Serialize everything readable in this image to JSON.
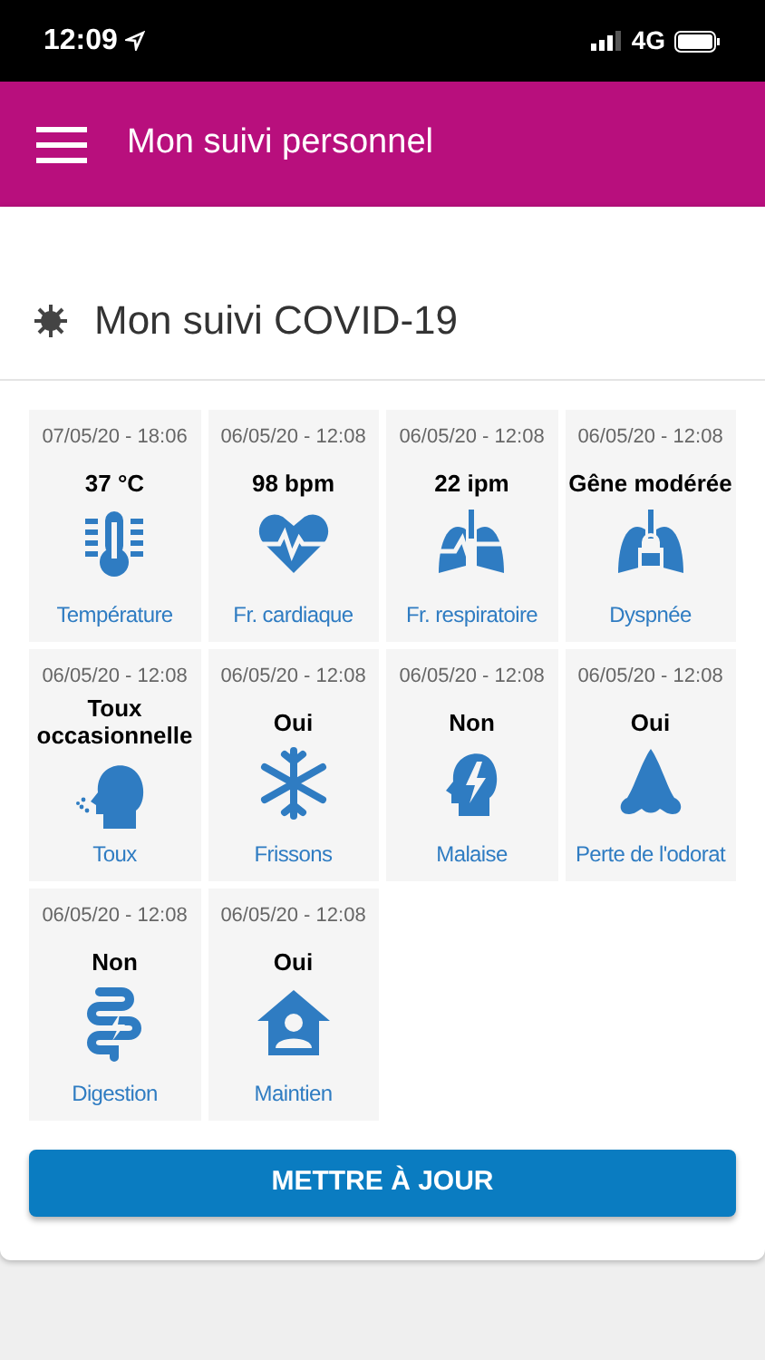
{
  "status_bar": {
    "time": "12:09",
    "network": "4G"
  },
  "header": {
    "title": "Mon suivi personnel"
  },
  "section": {
    "title": "Mon suivi COVID-19"
  },
  "tiles": [
    {
      "kind": "thermometer",
      "date": "07/05/20 - 18:06",
      "value": "37 °C",
      "label": "Température"
    },
    {
      "kind": "heart",
      "date": "06/05/20 - 12:08",
      "value": "98 bpm",
      "label": "Fr. cardiaque"
    },
    {
      "kind": "lungs-pulse",
      "date": "06/05/20 - 12:08",
      "value": "22 ipm",
      "label": "Fr. respiratoire"
    },
    {
      "kind": "lungs-lock",
      "date": "06/05/20 - 12:08",
      "value": "Gêne modérée",
      "label": "Dyspnée"
    },
    {
      "kind": "cough",
      "date": "06/05/20 - 12:08",
      "value": "Toux occasionnelle",
      "label": "Toux"
    },
    {
      "kind": "snowflake",
      "date": "06/05/20 - 12:08",
      "value": "Oui",
      "label": "Frissons"
    },
    {
      "kind": "head-bolt",
      "date": "06/05/20 - 12:08",
      "value": "Non",
      "label": "Malaise"
    },
    {
      "kind": "nose",
      "date": "06/05/20 - 12:08",
      "value": "Oui",
      "label": "Perte de l'odorat"
    },
    {
      "kind": "intestine",
      "date": "06/05/20 - 12:08",
      "value": "Non",
      "label": "Digestion"
    },
    {
      "kind": "house-person",
      "date": "06/05/20 - 12:08",
      "value": "Oui",
      "label": "Maintien"
    }
  ],
  "button": {
    "label": "METTRE À JOUR"
  }
}
